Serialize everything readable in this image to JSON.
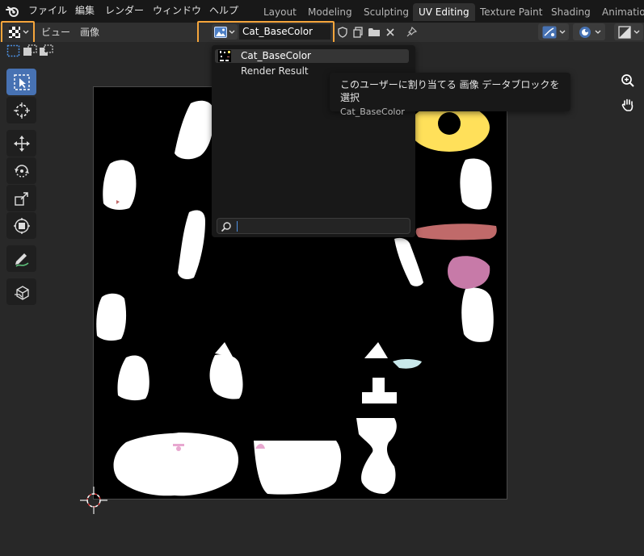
{
  "topbar": {
    "menus": [
      "ファイル",
      "編集",
      "レンダー",
      "ウィンドウ",
      "ヘルプ"
    ],
    "workspace_tabs": [
      {
        "label": "Layout",
        "active": false
      },
      {
        "label": "Modeling",
        "active": false
      },
      {
        "label": "Sculpting",
        "active": false
      },
      {
        "label": "UV Editing",
        "active": true
      },
      {
        "label": "Texture Paint",
        "active": false
      },
      {
        "label": "Shading",
        "active": false
      },
      {
        "label": "Animation",
        "active": false
      }
    ]
  },
  "header": {
    "menus": [
      "ビュー",
      "画像"
    ],
    "image_name": "Cat_BaseColor",
    "icons": [
      "shield-icon",
      "duplicate-icon",
      "folder-icon",
      "close-icon",
      "pin-icon"
    ]
  },
  "dropdown": {
    "items": [
      {
        "label": "Cat_BaseColor",
        "selected": true
      },
      {
        "label": "Render Result",
        "selected": false
      }
    ],
    "search_value": ""
  },
  "tooltip": {
    "text": "このユーザーに割り当てる 画像 データブロックを選択",
    "value": "Cat_BaseColor"
  },
  "toolbar": {
    "tools": [
      "select-box",
      "cursor",
      "move",
      "rotate",
      "scale",
      "transform",
      "annotate",
      "grab"
    ]
  },
  "colors": {
    "accent": "#4772b3",
    "highlight": "#f5a53b",
    "texture_yellow": "#ffe05a",
    "texture_red": "#c06a6a",
    "texture_pink": "#c77aa8"
  }
}
